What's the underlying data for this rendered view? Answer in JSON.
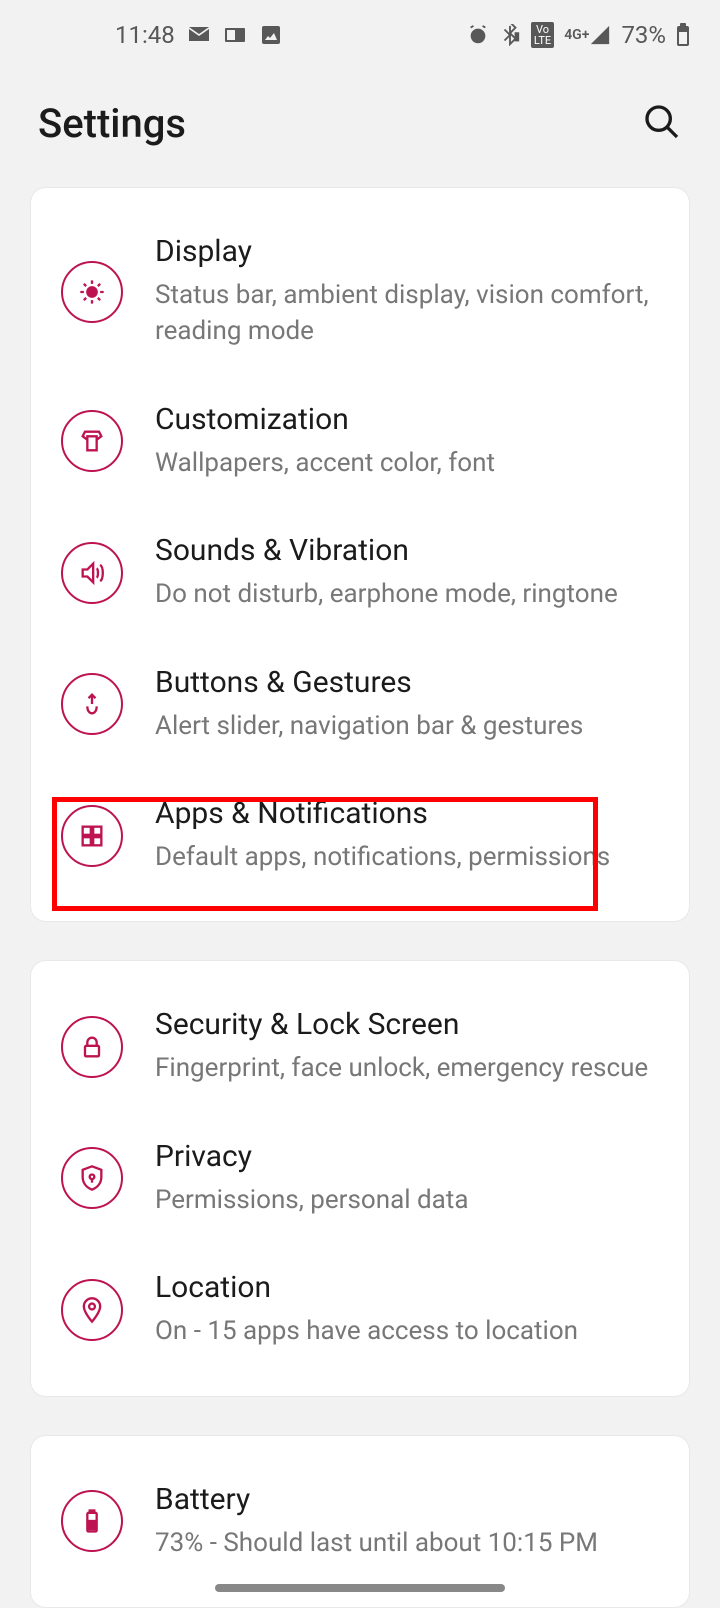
{
  "status_bar": {
    "time": "11:48",
    "battery_text": "73%"
  },
  "header": {
    "title": "Settings"
  },
  "groups": [
    {
      "items": [
        {
          "title": "Display",
          "subtitle": "Status bar, ambient display, vision comfort, reading mode"
        },
        {
          "title": "Customization",
          "subtitle": "Wallpapers, accent color, font"
        },
        {
          "title": "Sounds & Vibration",
          "subtitle": "Do not disturb, earphone mode, ringtone"
        },
        {
          "title": "Buttons & Gestures",
          "subtitle": "Alert slider, navigation bar & gestures"
        },
        {
          "title": "Apps & Notifications",
          "subtitle": "Default apps, notifications, permissions"
        }
      ]
    },
    {
      "items": [
        {
          "title": "Security & Lock Screen",
          "subtitle": "Fingerprint, face unlock, emergency rescue"
        },
        {
          "title": "Privacy",
          "subtitle": "Permissions, personal data"
        },
        {
          "title": "Location",
          "subtitle": "On - 15 apps have access to location"
        }
      ]
    },
    {
      "items": [
        {
          "title": "Battery",
          "subtitle": "73% - Should last until about 10:15 PM"
        }
      ]
    }
  ]
}
